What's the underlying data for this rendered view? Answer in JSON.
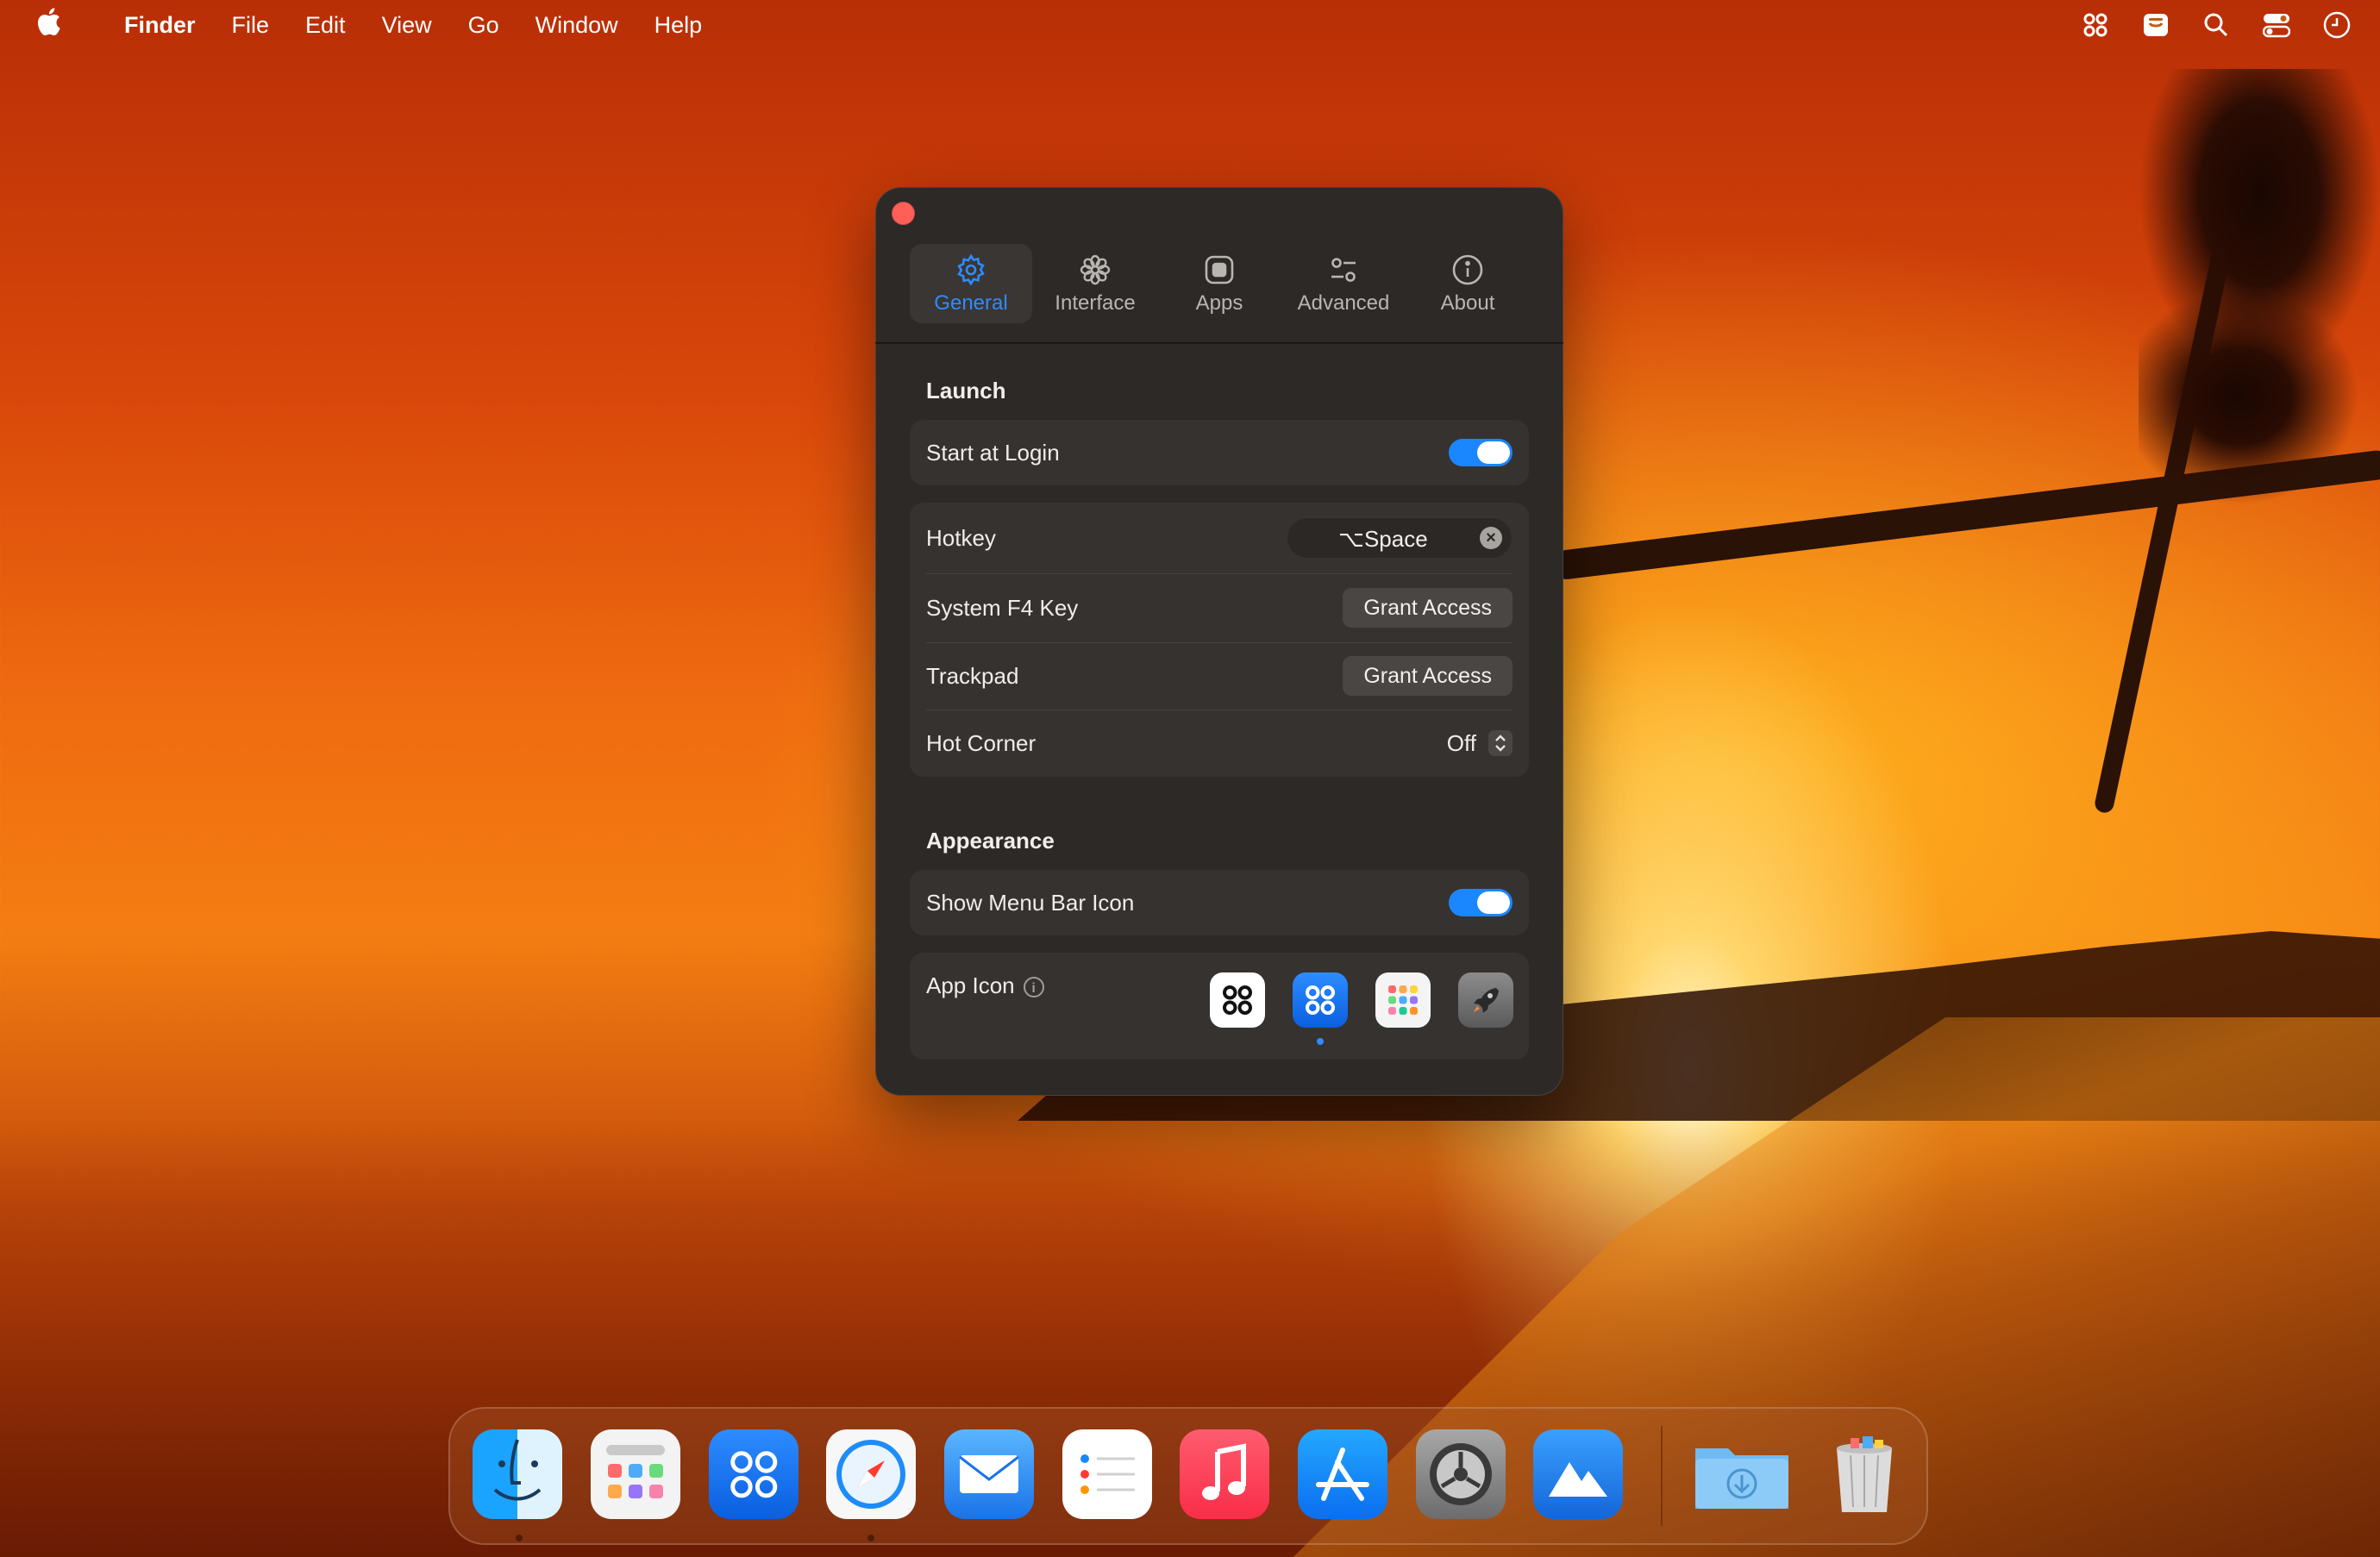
{
  "menubar": {
    "app_name": "Finder",
    "items": [
      "File",
      "Edit",
      "View",
      "Go",
      "Window",
      "Help"
    ],
    "status_icons": [
      "command-icon",
      "panel-icon",
      "search-icon",
      "control-center-icon",
      "clock-icon"
    ]
  },
  "window": {
    "tabs": [
      {
        "label": "General",
        "icon": "gear-icon",
        "active": true
      },
      {
        "label": "Interface",
        "icon": "flower-icon",
        "active": false
      },
      {
        "label": "Apps",
        "icon": "app-square-icon",
        "active": false
      },
      {
        "label": "Advanced",
        "icon": "sliders-icon",
        "active": false
      },
      {
        "label": "About",
        "icon": "info-icon",
        "active": false
      }
    ],
    "launch": {
      "title": "Launch",
      "start_at_login": {
        "label": "Start at Login",
        "on": true
      },
      "hotkey": {
        "label": "Hotkey",
        "value": "⌥Space"
      },
      "system_f4": {
        "label": "System F4 Key",
        "button": "Grant Access"
      },
      "trackpad": {
        "label": "Trackpad",
        "button": "Grant Access"
      },
      "hot_corner": {
        "label": "Hot Corner",
        "value": "Off"
      }
    },
    "appearance": {
      "title": "Appearance",
      "show_menu_bar_icon": {
        "label": "Show Menu Bar Icon",
        "on": true
      },
      "app_icon": {
        "label": "App Icon",
        "options": [
          "white-command-icon",
          "blue-command-icon",
          "color-grid-icon",
          "rocket-icon"
        ],
        "selected": 1
      }
    }
  },
  "dock": {
    "apps": [
      "finder-icon",
      "launchpad-icon",
      "command-app-icon",
      "safari-icon",
      "mail-icon",
      "reminders-icon",
      "music-icon",
      "app-store-icon",
      "system-settings-icon",
      "mountain-app-icon",
      "downloads-folder-icon",
      "trash-icon"
    ]
  },
  "colors": {
    "accent": "#2f8bff",
    "close": "#ff5f57",
    "window_bg": "#2c2927"
  }
}
